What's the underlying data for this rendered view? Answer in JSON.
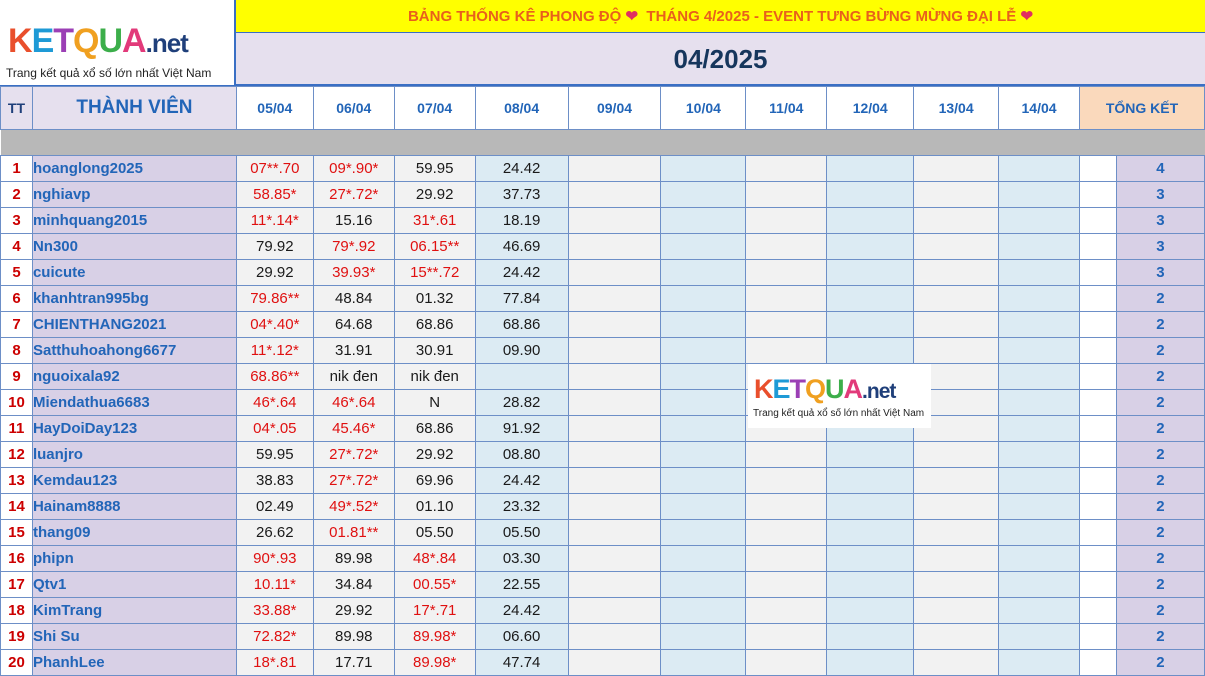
{
  "logo": {
    "letters": [
      "K",
      "E",
      "T",
      "Q",
      "U",
      "A"
    ],
    "suffix": ".net",
    "tagline": "Trang kết quả xổ số lớn nhất Việt Nam"
  },
  "title": {
    "left": "BẢNG THỐNG KÊ PHONG ĐỘ",
    "right": "THÁNG 4/2025 - EVENT TƯNG BỪNG MỪNG ĐẠI LỄ",
    "heart": "❤"
  },
  "month": "04/2025",
  "columns": {
    "tt": "TT",
    "member": "THÀNH VIÊN",
    "dates": [
      "05/04",
      "06/04",
      "07/04",
      "08/04",
      "09/04",
      "10/04",
      "11/04",
      "12/04",
      "13/04",
      "14/04"
    ],
    "total": "TỔNG KẾT"
  },
  "rows": [
    {
      "n": "1",
      "name": "hoanglong2025",
      "d": [
        "07**.70",
        "09*.90*",
        "59.95",
        "24.42"
      ],
      "red": [
        1,
        1,
        0,
        0
      ],
      "t": "4"
    },
    {
      "n": "2",
      "name": "nghiavp",
      "d": [
        "58.85*",
        "27*.72*",
        "29.92",
        "37.73"
      ],
      "red": [
        1,
        1,
        0,
        0
      ],
      "t": "3"
    },
    {
      "n": "3",
      "name": "minhquang2015",
      "d": [
        "11*.14*",
        "15.16",
        "31*.61",
        "18.19"
      ],
      "red": [
        1,
        0,
        1,
        0
      ],
      "t": "3"
    },
    {
      "n": "4",
      "name": "Nn300",
      "d": [
        "79.92",
        "79*.92",
        "06.15**",
        "46.69"
      ],
      "red": [
        0,
        1,
        1,
        0
      ],
      "t": "3"
    },
    {
      "n": "5",
      "name": "cuicute",
      "d": [
        "29.92",
        "39.93*",
        "15**.72",
        "24.42"
      ],
      "red": [
        0,
        1,
        1,
        0
      ],
      "t": "3"
    },
    {
      "n": "6",
      "name": "khanhtran995bg",
      "d": [
        "79.86**",
        "48.84",
        "01.32",
        "77.84"
      ],
      "red": [
        1,
        0,
        0,
        0
      ],
      "t": "2"
    },
    {
      "n": "7",
      "name": "CHIENTHANG2021",
      "d": [
        "04*.40*",
        "64.68",
        "68.86",
        "68.86"
      ],
      "red": [
        1,
        0,
        0,
        0
      ],
      "t": "2"
    },
    {
      "n": "8",
      "name": "Satthuhoahong6677",
      "d": [
        "11*.12*",
        "31.91",
        "30.91",
        "09.90"
      ],
      "red": [
        1,
        0,
        0,
        0
      ],
      "t": "2"
    },
    {
      "n": "9",
      "name": "nguoixala92",
      "d": [
        "68.86**",
        "nik đen",
        "nik đen",
        ""
      ],
      "red": [
        1,
        0,
        0,
        0
      ],
      "t": "2"
    },
    {
      "n": "10",
      "name": "Miendathua6683",
      "d": [
        "46*.64",
        "46*.64",
        "N",
        "28.82"
      ],
      "red": [
        1,
        1,
        0,
        0
      ],
      "t": "2"
    },
    {
      "n": "11",
      "name": "HayDoiDay123",
      "d": [
        "04*.05",
        "45.46*",
        "68.86",
        "91.92"
      ],
      "red": [
        1,
        1,
        0,
        0
      ],
      "t": "2"
    },
    {
      "n": "12",
      "name": "luanjro",
      "d": [
        "59.95",
        "27*.72*",
        "29.92",
        "08.80"
      ],
      "red": [
        0,
        1,
        0,
        0
      ],
      "t": "2"
    },
    {
      "n": "13",
      "name": "Kemdau123",
      "d": [
        "38.83",
        "27*.72*",
        "69.96",
        "24.42"
      ],
      "red": [
        0,
        1,
        0,
        0
      ],
      "t": "2"
    },
    {
      "n": "14",
      "name": "Hainam8888",
      "d": [
        "02.49",
        "49*.52*",
        "01.10",
        "23.32"
      ],
      "red": [
        0,
        1,
        0,
        0
      ],
      "t": "2"
    },
    {
      "n": "15",
      "name": "thang09",
      "d": [
        "26.62",
        "01.81**",
        "05.50",
        "05.50"
      ],
      "red": [
        0,
        1,
        0,
        0
      ],
      "t": "2"
    },
    {
      "n": "16",
      "name": "phipn",
      "d": [
        "90*.93",
        "89.98",
        "48*.84",
        "03.30"
      ],
      "red": [
        1,
        0,
        1,
        0
      ],
      "t": "2"
    },
    {
      "n": "17",
      "name": "Qtv1",
      "d": [
        "10.11*",
        "34.84",
        "00.55*",
        "22.55"
      ],
      "red": [
        1,
        0,
        1,
        0
      ],
      "t": "2"
    },
    {
      "n": "18",
      "name": "KimTrang",
      "d": [
        "33.88*",
        "29.92",
        "17*.71",
        "24.42"
      ],
      "red": [
        1,
        0,
        1,
        0
      ],
      "t": "2"
    },
    {
      "n": "19",
      "name": "Shi Su",
      "d": [
        "72.82*",
        "89.98",
        "89.98*",
        "06.60"
      ],
      "red": [
        1,
        0,
        1,
        0
      ],
      "t": "2"
    },
    {
      "n": "20",
      "name": "PhanhLee",
      "d": [
        "18*.81",
        "17.71",
        "89.98*",
        "47.74"
      ],
      "red": [
        1,
        0,
        1,
        0
      ],
      "t": "2"
    }
  ]
}
